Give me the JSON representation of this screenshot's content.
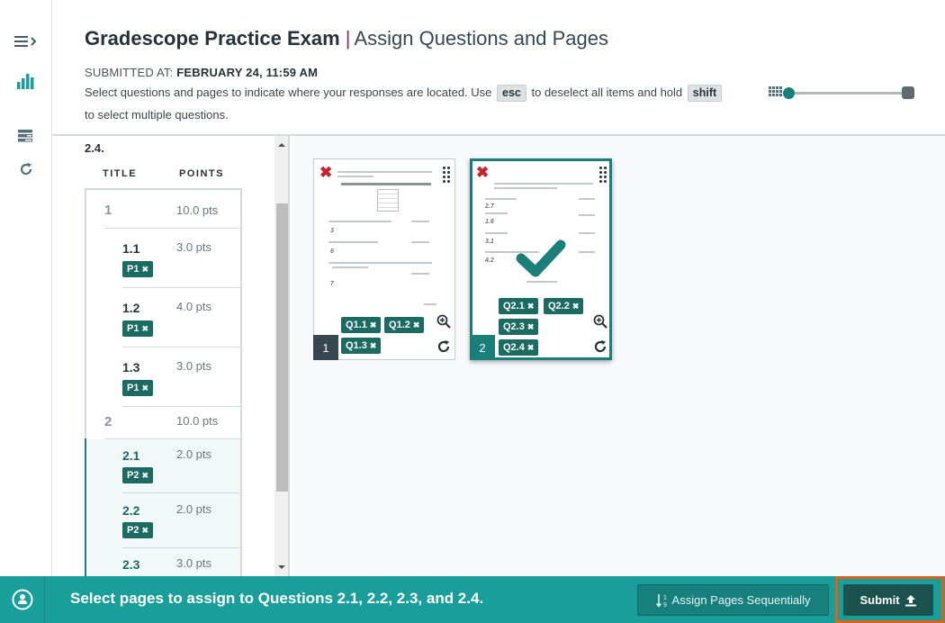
{
  "header": {
    "exam_title": "Gradescope Practice Exam",
    "separator": "|",
    "subtitle": "Assign Questions and Pages",
    "submitted_label": "SUBMITTED AT:",
    "submitted_value": "FEBRUARY 24, 11:59 AM",
    "instructions_part1": "Select questions and pages to indicate where your responses are located. Use",
    "key_esc": "esc",
    "instructions_part2": "to deselect all items and hold",
    "key_shift": "shift",
    "instructions_part3": "to select multiple questions."
  },
  "zoom_slider": {
    "value_percent": 0
  },
  "rail": {
    "icons": [
      "menu-expand-icon",
      "stats-icon",
      "outline-icon",
      "reload-icon"
    ]
  },
  "questions_panel": {
    "crumb": "2.4.",
    "col_title": "TITLE",
    "col_points": "POINTS",
    "rows": [
      {
        "num": "1",
        "points": "10.0 pts",
        "type": "parent"
      },
      {
        "num": "1.1",
        "points": "3.0 pts",
        "type": "child",
        "tag": "P1"
      },
      {
        "num": "1.2",
        "points": "4.0 pts",
        "type": "child",
        "tag": "P1"
      },
      {
        "num": "1.3",
        "points": "3.0 pts",
        "type": "child",
        "tag": "P1"
      },
      {
        "num": "2",
        "points": "10.0 pts",
        "type": "parent"
      },
      {
        "num": "2.1",
        "points": "2.0 pts",
        "type": "child",
        "tag": "P2",
        "active": true
      },
      {
        "num": "2.2",
        "points": "2.0 pts",
        "type": "child",
        "tag": "P2",
        "active": true
      },
      {
        "num": "2.3",
        "points": "3.0 pts",
        "type": "child",
        "active": true
      }
    ],
    "tag_remove": "✖"
  },
  "pages": [
    {
      "number": "1",
      "selected": false,
      "tags": [
        "Q1.1",
        "Q1.2",
        "Q1.3"
      ],
      "answers": [
        "3",
        "6",
        "7"
      ]
    },
    {
      "number": "2",
      "selected": true,
      "tags": [
        "Q2.1",
        "Q2.2",
        "Q2.3",
        "Q2.4"
      ],
      "answers": [
        "2.7",
        "1.6",
        "3.1",
        "4.2"
      ]
    }
  ],
  "bottom_bar": {
    "message": "Select pages to assign to Questions 2.1, 2.2, 2.3, and 2.4.",
    "assign_sequential_label": "Assign Pages Sequentially",
    "submit_label": "Submit"
  },
  "colors": {
    "accent": "#1a9e9a",
    "tag": "#1b6b62",
    "submit": "#1b524e",
    "highlight_outline": "#d9621e",
    "unassigned_x": "#c8232c"
  }
}
